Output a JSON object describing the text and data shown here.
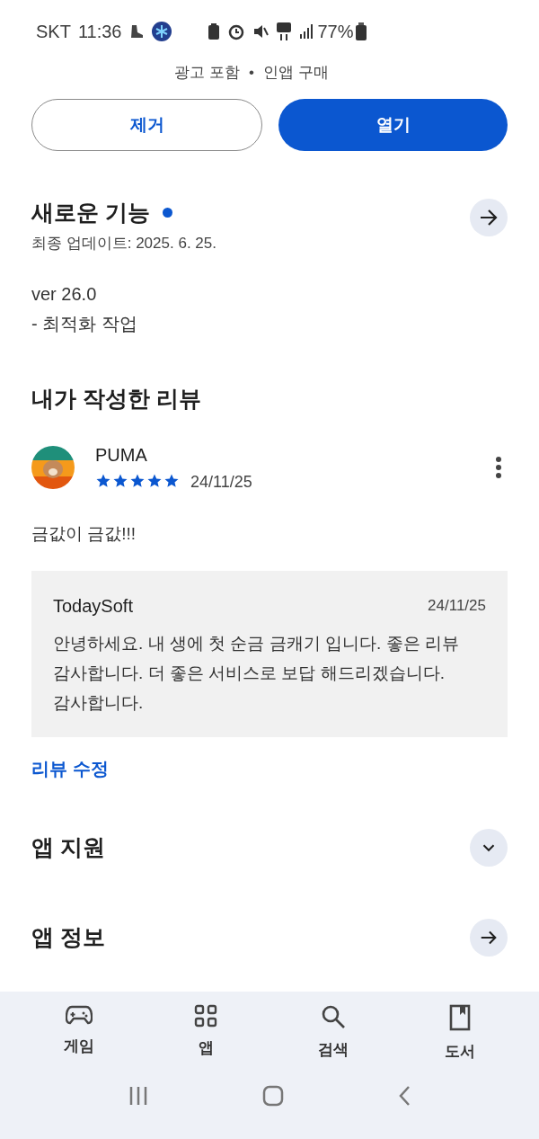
{
  "status_bar": {
    "carrier": "SKT",
    "time": "11:36",
    "battery": "77%"
  },
  "app_meta": {
    "ads": "광고 포함",
    "separator": "•",
    "purchases": "인앱 구매"
  },
  "buttons": [
    {
      "label": "제거",
      "kind": "outlined"
    },
    {
      "label": "열기",
      "kind": "filled"
    }
  ],
  "whats_new": {
    "title": "새로운 기능",
    "updated": "최종 업데이트: 2025. 6. 25.",
    "notes": [
      "ver 26.0",
      "- 최적화 작업"
    ]
  },
  "my_review": {
    "title": "내가 작성한 리뷰",
    "author": "PUMA",
    "stars": 5,
    "date": "24/11/25",
    "text": "금값이 금값!!!",
    "reply": {
      "author": "TodaySoft",
      "date": "24/11/25",
      "text": "안녕하세요. 내 생에 첫 순금 금캐기 입니다. 좋은 리뷰 감사합니다. 더 좋은 서비스로 보답 해드리겠습니다. 감사합니다."
    },
    "edit_link": "리뷰 수정"
  },
  "sections": [
    {
      "title": "앱 지원",
      "kind": "expand"
    },
    {
      "title": "앱 정보",
      "kind": "open"
    }
  ],
  "bottom_nav": [
    {
      "label": "게임",
      "kind": "games"
    },
    {
      "label": "앱",
      "kind": "apps"
    },
    {
      "label": "검색",
      "kind": "search"
    },
    {
      "label": "도서",
      "kind": "books"
    }
  ]
}
